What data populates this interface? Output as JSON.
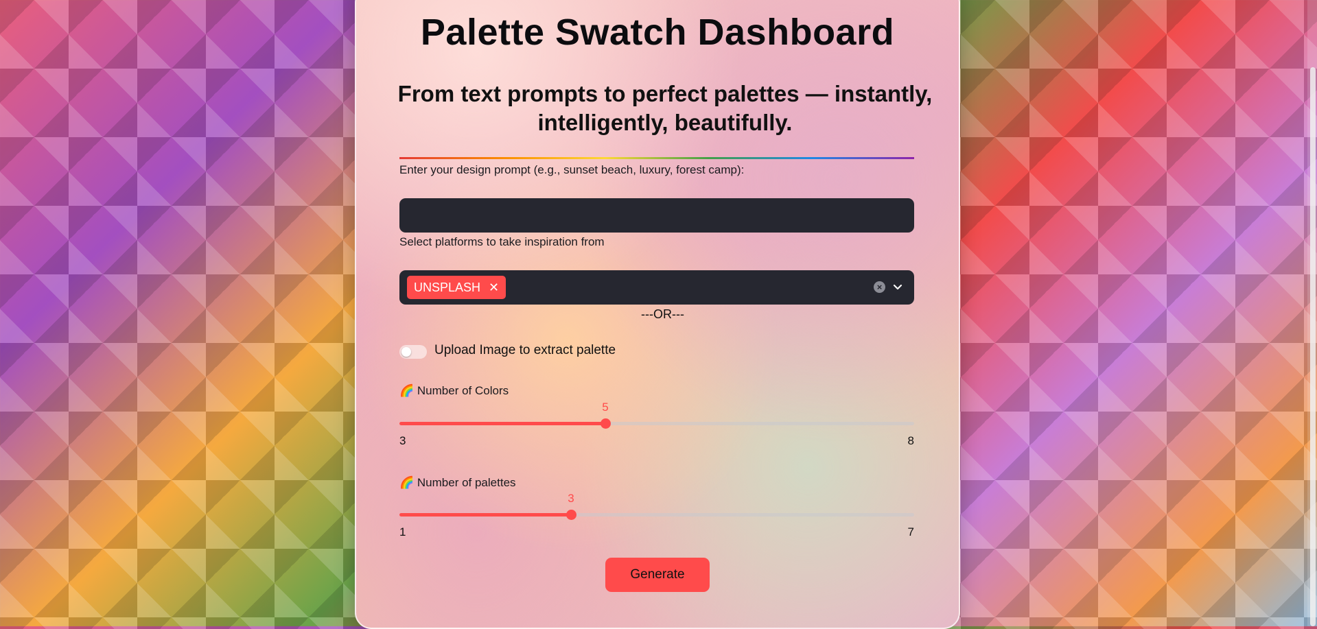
{
  "header": {
    "title": "Palette Swatch Dashboard",
    "subtitle": "From text prompts to perfect palettes — instantly, intelligently, beautifully."
  },
  "prompt": {
    "label": "Enter your design prompt (e.g., sunset beach, luxury, forest camp):",
    "value": "",
    "placeholder": ""
  },
  "platforms": {
    "label": "Select platforms to take inspiration from",
    "selected": [
      "UNSPLASH"
    ]
  },
  "divider": "---OR---",
  "upload_toggle": {
    "label": "Upload Image to extract palette",
    "enabled": false
  },
  "colors_slider": {
    "label": "🌈 Number of Colors",
    "value": 5,
    "min": 3,
    "max": 8
  },
  "palettes_slider": {
    "label": "🌈 Number of palettes",
    "value": 3,
    "min": 1,
    "max": 7
  },
  "actions": {
    "generate_label": "Generate"
  },
  "colors": {
    "accent": "#ff4b4b",
    "input_bg": "#262730"
  }
}
